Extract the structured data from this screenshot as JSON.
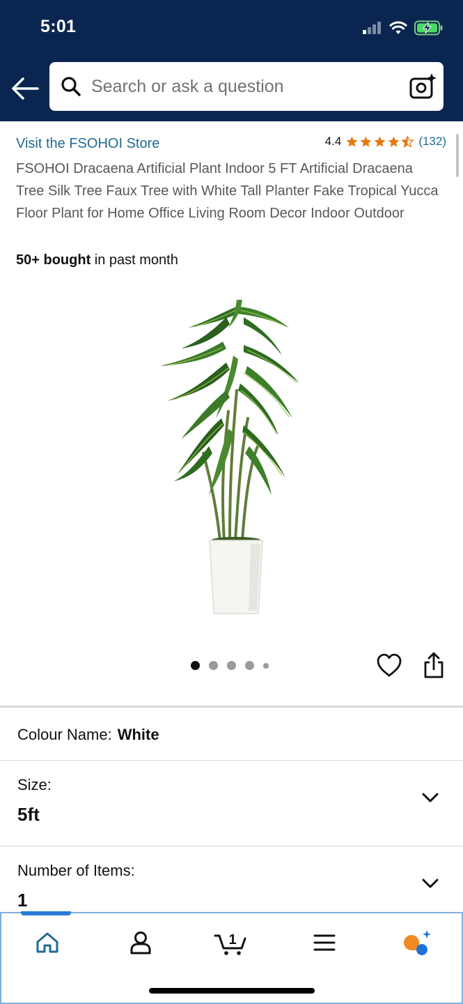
{
  "status_bar": {
    "time": "5:01"
  },
  "search": {
    "placeholder": "Search or ask a question"
  },
  "product": {
    "store_link": "Visit the FSOHOI Store",
    "rating": "4.4",
    "stars": 4.4,
    "review_count": "(132)",
    "title": "FSOHOI Dracaena Artificial Plant Indoor 5 FT Artificial Dracaena Tree Silk Tree Faux Tree with White Tall Planter Fake Tropical Yucca Floor Plant for Home Office Living Room Decor Indoor Outdoor",
    "bought_strong": "50+ bought",
    "bought_rest": " in past month",
    "image_count": 5,
    "active_image": 1
  },
  "options": {
    "colour_label": "Colour Name:",
    "colour_value": "White",
    "size_label": "Size:",
    "size_value": "5ft",
    "items_label": "Number of Items:",
    "items_value": "1"
  },
  "nav": {
    "cart_count": "1"
  },
  "colors": {
    "header": "#0a2650",
    "link": "#1f6b8f",
    "star": "#e47911",
    "nav_active": "#2a7bd8"
  }
}
